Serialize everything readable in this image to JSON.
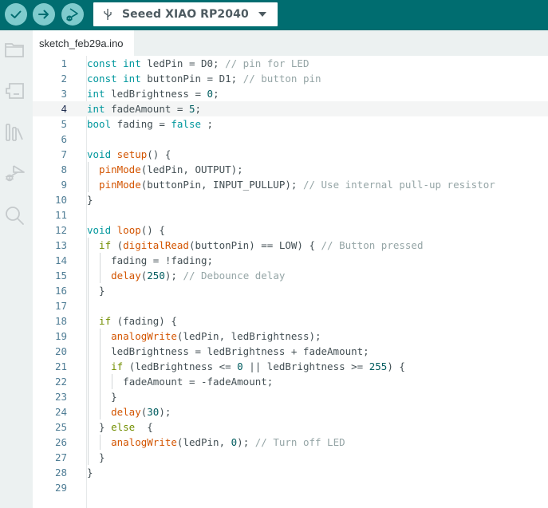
{
  "toolbar": {
    "buttons": [
      {
        "name": "verify",
        "icon": "check-icon"
      },
      {
        "name": "upload",
        "icon": "arrow-right-icon"
      },
      {
        "name": "debug",
        "icon": "debug-play-icon"
      }
    ],
    "board_selector": {
      "icon": "usb-icon",
      "label": "Seeed XIAO RP2040"
    },
    "accent_color": "#006d70",
    "button_color": "#7fcbcd"
  },
  "sidebar": {
    "items": [
      {
        "name": "sketchbook",
        "icon": "folder-icon"
      },
      {
        "name": "boards-manager",
        "icon": "board-icon"
      },
      {
        "name": "library-manager",
        "icon": "library-icon"
      },
      {
        "name": "debug",
        "icon": "debug-icon"
      },
      {
        "name": "search",
        "icon": "search-icon"
      }
    ]
  },
  "tabs": [
    {
      "label": "sketch_feb29a.ino",
      "active": true
    }
  ],
  "editor": {
    "active_line": 4,
    "lines": [
      [
        [
          "kw",
          "const int"
        ],
        [
          "",
          "ledPin = D0; "
        ],
        [
          "cm",
          "// pin for LED"
        ]
      ],
      [
        [
          "kw",
          "const int"
        ],
        [
          "",
          "buttonPin = D1; "
        ],
        [
          "cm",
          "// button pin"
        ]
      ],
      [
        [
          "kw",
          "int"
        ],
        [
          "",
          "ledBrightness = "
        ],
        [
          "num",
          "0"
        ],
        [
          "",
          ";"
        ]
      ],
      [
        [
          "kw",
          "int"
        ],
        [
          "",
          "fadeAmount = "
        ],
        [
          "num",
          "5"
        ],
        [
          "",
          ";"
        ]
      ],
      [
        [
          "kw",
          "bool"
        ],
        [
          "",
          "fading = "
        ],
        [
          "kw",
          "false"
        ],
        [
          "",
          ";"
        ]
      ],
      [],
      [
        [
          "kw",
          "void"
        ],
        [
          "",
          ""
        ],
        [
          "fn",
          "setup"
        ],
        [
          "",
          "() {"
        ]
      ],
      [
        [
          "",
          ""
        ],
        [
          "fn",
          "pinMode"
        ],
        [
          "",
          "(ledPin, OUTPUT);"
        ]
      ],
      [
        [
          "",
          ""
        ],
        [
          "fn",
          "pinMode"
        ],
        [
          "",
          "(buttonPin, INPUT_PULLUP); "
        ],
        [
          "cm",
          "// Use internal pull-up resistor"
        ]
      ],
      [
        [
          "",
          "}"
        ]
      ],
      [],
      [
        [
          "kw",
          "void"
        ],
        [
          "",
          ""
        ],
        [
          "fn",
          "loop"
        ],
        [
          "",
          "() {"
        ]
      ],
      [
        [
          "ctl",
          "if"
        ],
        [
          "",
          "("
        ],
        [
          "fn",
          "digitalRead"
        ],
        [
          "",
          "(buttonPin) == LOW) { "
        ],
        [
          "cm",
          "// Button pressed"
        ]
      ],
      [
        [
          "",
          "fading = !fading;"
        ]
      ],
      [
        [
          "fn",
          "delay"
        ],
        [
          "",
          "("
        ],
        [
          "num",
          "250"
        ],
        [
          "",
          "); "
        ],
        [
          "cm",
          "// Debounce delay"
        ]
      ],
      [
        [
          "",
          "}"
        ]
      ],
      [],
      [
        [
          "ctl",
          "if"
        ],
        [
          "",
          "(fading) {"
        ]
      ],
      [
        [
          "fn",
          "analogWrite"
        ],
        [
          "",
          "(ledPin, ledBrightness);"
        ]
      ],
      [
        [
          "",
          "ledBrightness = ledBrightness + fadeAmount;"
        ]
      ],
      [
        [
          "ctl",
          "if"
        ],
        [
          "",
          "(ledBrightness <= "
        ],
        [
          "num",
          "0"
        ],
        [
          "",
          " || ledBrightness >= "
        ],
        [
          "num",
          "255"
        ],
        [
          "",
          ") {"
        ]
      ],
      [
        [
          "",
          "fadeAmount = -fadeAmount;"
        ]
      ],
      [
        [
          "",
          "}"
        ]
      ],
      [
        [
          "fn",
          "delay"
        ],
        [
          "",
          "("
        ],
        [
          "num",
          "30"
        ],
        [
          "",
          ");"
        ]
      ],
      [
        [
          "",
          "} "
        ],
        [
          "ctl",
          "else"
        ],
        [
          "",
          " {"
        ]
      ],
      [
        [
          "fn",
          "analogWrite"
        ],
        [
          "",
          "(ledPin, "
        ],
        [
          "num",
          "0"
        ],
        [
          "",
          "); "
        ],
        [
          "cm",
          "// Turn off LED"
        ]
      ],
      [
        [
          "",
          "}"
        ]
      ],
      [
        [
          "",
          "}"
        ]
      ],
      []
    ],
    "indents": [
      0,
      0,
      0,
      0,
      0,
      0,
      0,
      1,
      1,
      0,
      0,
      0,
      1,
      2,
      2,
      1,
      0,
      1,
      2,
      2,
      2,
      3,
      2,
      2,
      1,
      2,
      1,
      0,
      0
    ]
  }
}
